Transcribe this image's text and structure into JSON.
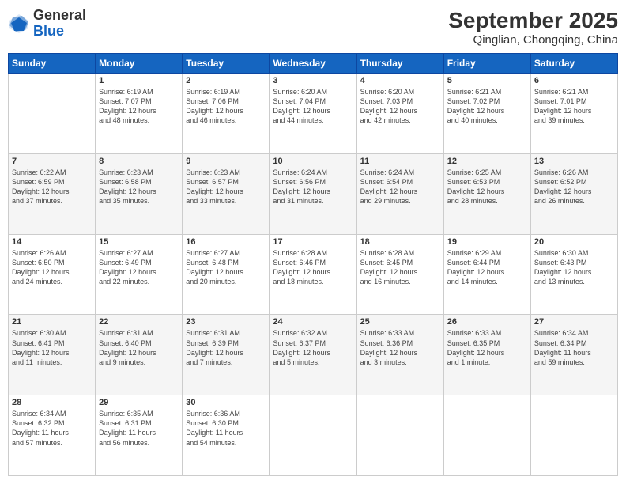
{
  "header": {
    "logo_general": "General",
    "logo_blue": "Blue",
    "title": "September 2025",
    "subtitle": "Qinglian, Chongqing, China"
  },
  "days_of_week": [
    "Sunday",
    "Monday",
    "Tuesday",
    "Wednesday",
    "Thursday",
    "Friday",
    "Saturday"
  ],
  "weeks": [
    [
      {
        "day": "",
        "info": ""
      },
      {
        "day": "1",
        "info": "Sunrise: 6:19 AM\nSunset: 7:07 PM\nDaylight: 12 hours\nand 48 minutes."
      },
      {
        "day": "2",
        "info": "Sunrise: 6:19 AM\nSunset: 7:06 PM\nDaylight: 12 hours\nand 46 minutes."
      },
      {
        "day": "3",
        "info": "Sunrise: 6:20 AM\nSunset: 7:04 PM\nDaylight: 12 hours\nand 44 minutes."
      },
      {
        "day": "4",
        "info": "Sunrise: 6:20 AM\nSunset: 7:03 PM\nDaylight: 12 hours\nand 42 minutes."
      },
      {
        "day": "5",
        "info": "Sunrise: 6:21 AM\nSunset: 7:02 PM\nDaylight: 12 hours\nand 40 minutes."
      },
      {
        "day": "6",
        "info": "Sunrise: 6:21 AM\nSunset: 7:01 PM\nDaylight: 12 hours\nand 39 minutes."
      }
    ],
    [
      {
        "day": "7",
        "info": "Sunrise: 6:22 AM\nSunset: 6:59 PM\nDaylight: 12 hours\nand 37 minutes."
      },
      {
        "day": "8",
        "info": "Sunrise: 6:23 AM\nSunset: 6:58 PM\nDaylight: 12 hours\nand 35 minutes."
      },
      {
        "day": "9",
        "info": "Sunrise: 6:23 AM\nSunset: 6:57 PM\nDaylight: 12 hours\nand 33 minutes."
      },
      {
        "day": "10",
        "info": "Sunrise: 6:24 AM\nSunset: 6:56 PM\nDaylight: 12 hours\nand 31 minutes."
      },
      {
        "day": "11",
        "info": "Sunrise: 6:24 AM\nSunset: 6:54 PM\nDaylight: 12 hours\nand 29 minutes."
      },
      {
        "day": "12",
        "info": "Sunrise: 6:25 AM\nSunset: 6:53 PM\nDaylight: 12 hours\nand 28 minutes."
      },
      {
        "day": "13",
        "info": "Sunrise: 6:26 AM\nSunset: 6:52 PM\nDaylight: 12 hours\nand 26 minutes."
      }
    ],
    [
      {
        "day": "14",
        "info": "Sunrise: 6:26 AM\nSunset: 6:50 PM\nDaylight: 12 hours\nand 24 minutes."
      },
      {
        "day": "15",
        "info": "Sunrise: 6:27 AM\nSunset: 6:49 PM\nDaylight: 12 hours\nand 22 minutes."
      },
      {
        "day": "16",
        "info": "Sunrise: 6:27 AM\nSunset: 6:48 PM\nDaylight: 12 hours\nand 20 minutes."
      },
      {
        "day": "17",
        "info": "Sunrise: 6:28 AM\nSunset: 6:46 PM\nDaylight: 12 hours\nand 18 minutes."
      },
      {
        "day": "18",
        "info": "Sunrise: 6:28 AM\nSunset: 6:45 PM\nDaylight: 12 hours\nand 16 minutes."
      },
      {
        "day": "19",
        "info": "Sunrise: 6:29 AM\nSunset: 6:44 PM\nDaylight: 12 hours\nand 14 minutes."
      },
      {
        "day": "20",
        "info": "Sunrise: 6:30 AM\nSunset: 6:43 PM\nDaylight: 12 hours\nand 13 minutes."
      }
    ],
    [
      {
        "day": "21",
        "info": "Sunrise: 6:30 AM\nSunset: 6:41 PM\nDaylight: 12 hours\nand 11 minutes."
      },
      {
        "day": "22",
        "info": "Sunrise: 6:31 AM\nSunset: 6:40 PM\nDaylight: 12 hours\nand 9 minutes."
      },
      {
        "day": "23",
        "info": "Sunrise: 6:31 AM\nSunset: 6:39 PM\nDaylight: 12 hours\nand 7 minutes."
      },
      {
        "day": "24",
        "info": "Sunrise: 6:32 AM\nSunset: 6:37 PM\nDaylight: 12 hours\nand 5 minutes."
      },
      {
        "day": "25",
        "info": "Sunrise: 6:33 AM\nSunset: 6:36 PM\nDaylight: 12 hours\nand 3 minutes."
      },
      {
        "day": "26",
        "info": "Sunrise: 6:33 AM\nSunset: 6:35 PM\nDaylight: 12 hours\nand 1 minute."
      },
      {
        "day": "27",
        "info": "Sunrise: 6:34 AM\nSunset: 6:34 PM\nDaylight: 11 hours\nand 59 minutes."
      }
    ],
    [
      {
        "day": "28",
        "info": "Sunrise: 6:34 AM\nSunset: 6:32 PM\nDaylight: 11 hours\nand 57 minutes."
      },
      {
        "day": "29",
        "info": "Sunrise: 6:35 AM\nSunset: 6:31 PM\nDaylight: 11 hours\nand 56 minutes."
      },
      {
        "day": "30",
        "info": "Sunrise: 6:36 AM\nSunset: 6:30 PM\nDaylight: 11 hours\nand 54 minutes."
      },
      {
        "day": "",
        "info": ""
      },
      {
        "day": "",
        "info": ""
      },
      {
        "day": "",
        "info": ""
      },
      {
        "day": "",
        "info": ""
      }
    ]
  ]
}
